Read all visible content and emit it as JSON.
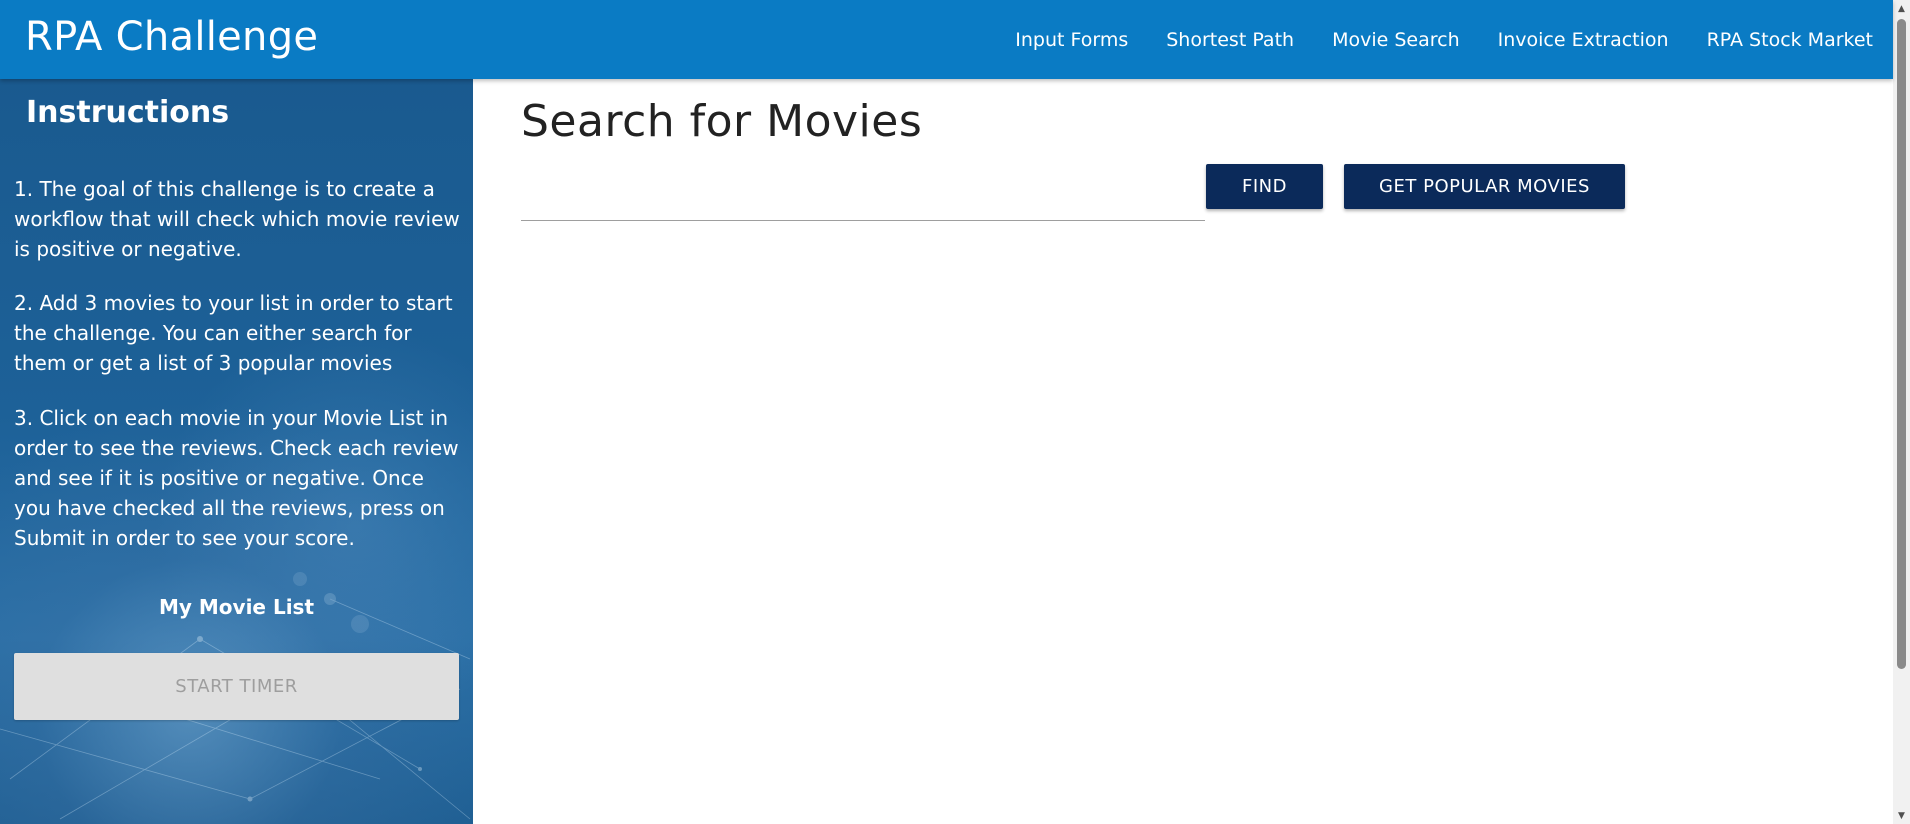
{
  "header": {
    "brand": "RPA Challenge",
    "nav": [
      {
        "label": "Input Forms"
      },
      {
        "label": "Shortest Path"
      },
      {
        "label": "Movie Search"
      },
      {
        "label": "Invoice Extraction"
      },
      {
        "label": "RPA Stock Market"
      }
    ]
  },
  "sidebar": {
    "title": "Instructions",
    "instructions": [
      "1. The goal of this challenge is to create a workflow that will check which movie review is positive or negative.",
      "2. Add 3 movies to your list in order to start the challenge. You can either search for them or get a list of 3 popular movies",
      "3. Click on each movie in your Movie List in order to see the reviews. Check each review and see if it is positive or negative. Once you have checked all the reviews, press on Submit in order to see your score."
    ],
    "movie_list_title": "My Movie List",
    "start_timer_label": "START TIMER"
  },
  "main": {
    "title": "Search for Movies",
    "search": {
      "value": "",
      "placeholder": ""
    },
    "find_label": "FIND",
    "popular_label": "GET POPULAR MOVIES"
  },
  "colors": {
    "header": "#0a7bc4",
    "button": "#0b2a5a",
    "disabled_button": "#dfdfdf"
  },
  "icons": {
    "scroll_up": "triangle-up-icon",
    "scroll_down": "triangle-down-icon"
  }
}
